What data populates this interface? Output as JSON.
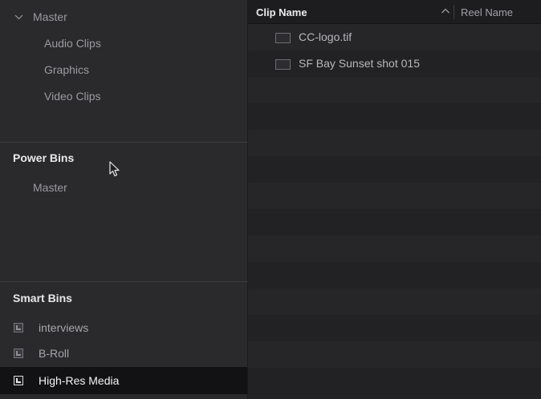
{
  "sidebar": {
    "master": {
      "label": "Master"
    },
    "master_children": [
      "Audio Clips",
      "Graphics",
      "Video Clips"
    ],
    "power_bins": {
      "title": "Power Bins",
      "items": [
        "Master"
      ]
    },
    "smart_bins": {
      "title": "Smart Bins",
      "items": [
        {
          "label": "interviews",
          "selected": false
        },
        {
          "label": "B-Roll",
          "selected": false
        },
        {
          "label": "High-Res Media",
          "selected": true
        }
      ]
    }
  },
  "media_pool": {
    "columns": {
      "clip_name": "Clip Name",
      "reel_name": "Reel Name"
    },
    "sort": "ascending",
    "clips": [
      {
        "name": "CC-logo.tif"
      },
      {
        "name": "SF Bay Sunset shot 015"
      }
    ]
  },
  "colors": {
    "sidebar_bg": "#2a2a2c",
    "selected_bg": "#121214",
    "row_odd": "#262628",
    "row_even": "#222224",
    "header_bg": "#1d1d1f"
  }
}
